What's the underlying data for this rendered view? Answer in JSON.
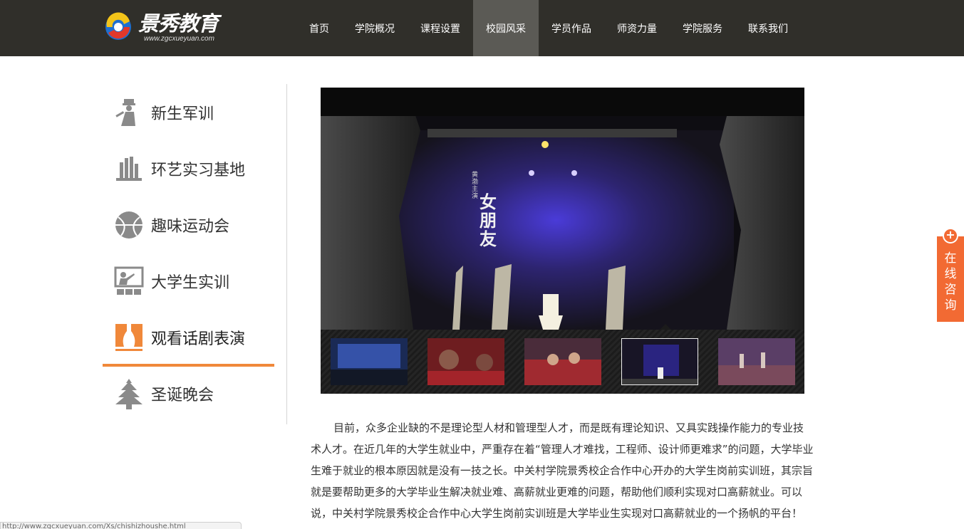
{
  "brand": {
    "name": "景秀教育",
    "url_text": "www.zgcxueyuan.com"
  },
  "nav": {
    "items": [
      {
        "label": "首页",
        "active": false
      },
      {
        "label": "学院概况",
        "active": false
      },
      {
        "label": "课程设置",
        "active": false
      },
      {
        "label": "校园风采",
        "active": true
      },
      {
        "label": "学员作品",
        "active": false
      },
      {
        "label": "师资力量",
        "active": false
      },
      {
        "label": "学院服务",
        "active": false
      },
      {
        "label": "联系我们",
        "active": false
      }
    ]
  },
  "sidebar": {
    "items": [
      {
        "label": "新生军训",
        "icon": "military-training-icon",
        "active": false
      },
      {
        "label": "环艺实习基地",
        "icon": "buildings-icon",
        "active": false
      },
      {
        "label": "趣味运动会",
        "icon": "ball-icon",
        "active": false
      },
      {
        "label": "大学生实训",
        "icon": "presentation-icon",
        "active": false
      },
      {
        "label": "观看话剧表演",
        "icon": "theater-curtain-icon",
        "active": true
      },
      {
        "label": "圣诞晚会",
        "icon": "christmas-tree-icon",
        "active": false
      }
    ]
  },
  "gallery": {
    "main_caption": "女朋友",
    "main_small_caption": "黄渤主演",
    "thumbnails": [
      {
        "index": 1,
        "selected": false
      },
      {
        "index": 2,
        "selected": false
      },
      {
        "index": 3,
        "selected": false
      },
      {
        "index": 4,
        "selected": true
      },
      {
        "index": 5,
        "selected": false
      }
    ]
  },
  "article": {
    "text": "目前，众多企业缺的不是理论型人材和管理型人才，而是既有理论知识、又具实践操作能力的专业技术人才。在近几年的大学生就业中，严重存在着“管理人才难找，工程师、设计师更难求”的问题，大学毕业生难于就业的根本原因就是没有一技之长。中关村学院景秀校企合作中心开办的大学生岗前实训班，其宗旨就是要帮助更多的大学毕业生解决就业难、高薪就业更难的问题，帮助他们顺利实现对口高薪就业。可以说，中关村学院景秀校企合作中心大学生岗前实训班是大学毕业生实现对口高薪就业的一个扬帆的平台！"
  },
  "consult": {
    "label": "在线咨询",
    "plus": "+"
  },
  "statusbar": {
    "text": "http://www.zgcxueyuan.com/Xs/chishizhoushe.html"
  },
  "colors": {
    "header_bg": "#302f2a",
    "nav_active_bg": "#5b5a55",
    "accent": "#f0883a",
    "consult_bg": "#f26a33"
  }
}
